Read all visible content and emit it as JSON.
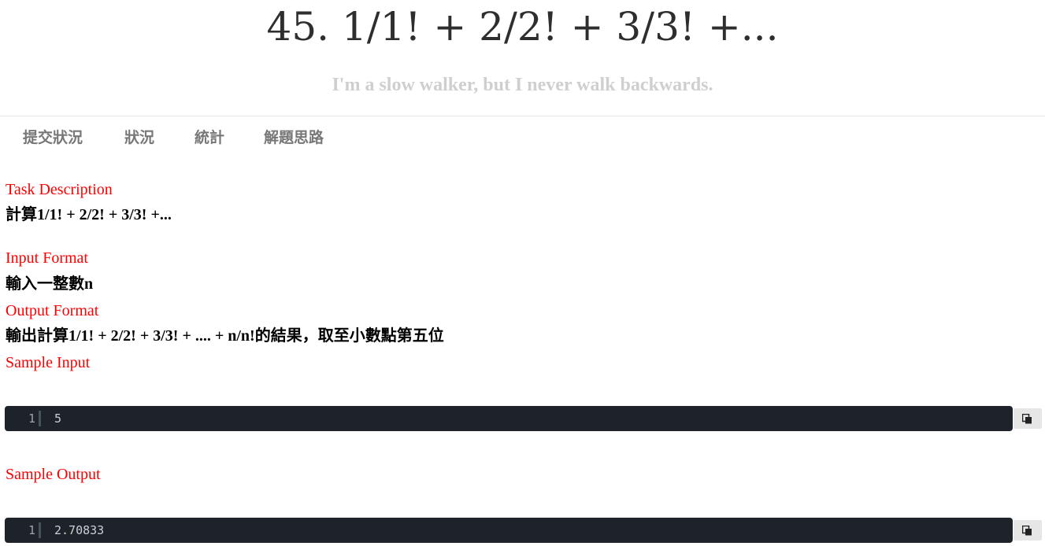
{
  "header": {
    "title": "45. 1/1! + 2/2! + 3/3! +...",
    "subtitle": "I'm a slow walker, but I never walk backwards."
  },
  "nav": {
    "tabs": [
      {
        "label": "提交狀況"
      },
      {
        "label": "狀況"
      },
      {
        "label": "統計"
      },
      {
        "label": "解題思路"
      }
    ]
  },
  "problem": {
    "task_description_label": "Task Description",
    "task_description_text": "計算1/1! + 2/2! + 3/3! +...",
    "input_format_label": "Input Format",
    "input_format_text": "輸入一整數n",
    "output_format_label": "Output Format",
    "output_format_text": "輸出計算1/1! + 2/2! + 3/3! + .... + n/n!的結果，取至小數點第五位",
    "sample_input_label": "Sample Input",
    "sample_input": {
      "line_number": "1",
      "code": "5"
    },
    "sample_output_label": "Sample Output",
    "sample_output": {
      "line_number": "1",
      "code": "2.70833"
    }
  },
  "icons": {
    "copy": "copy-icon"
  },
  "colors": {
    "section_label": "#ff0000",
    "code_background": "#1d2328",
    "subtitle": "#cfcfcf",
    "nav_text": "#777777"
  }
}
